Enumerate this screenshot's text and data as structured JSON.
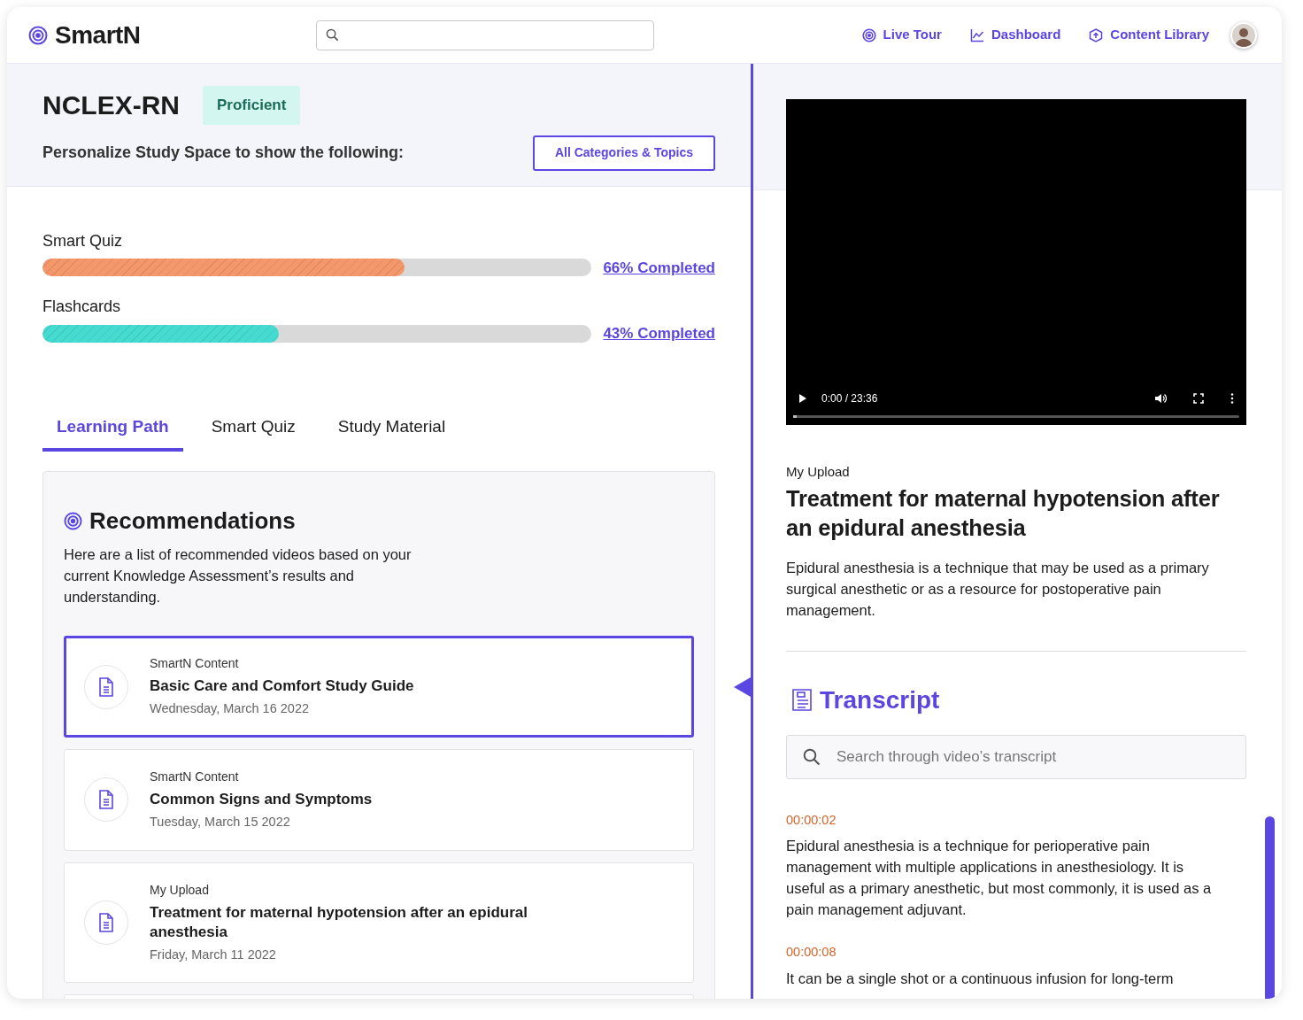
{
  "header": {
    "brand": "SmartN",
    "nav": [
      {
        "kind": "tour",
        "label": "Live Tour"
      },
      {
        "kind": "dashboard",
        "label": "Dashboard"
      },
      {
        "kind": "library",
        "label": "Content Library"
      }
    ]
  },
  "exam": {
    "title": "NCLEX-RN",
    "badge": "Proficient",
    "prompt": "Personalize Study Space to show the following:",
    "filter_button": "All Categories & Topics"
  },
  "progress": [
    {
      "label": "Smart Quiz",
      "level": 0.66,
      "link": "66% Completed",
      "color": "#f4976a"
    },
    {
      "label": "Flashcards",
      "level": 0.43,
      "link": "43% Completed",
      "color": "#45dbd0"
    }
  ],
  "tabs": [
    {
      "label": "Learning Path",
      "selected": true
    },
    {
      "label": "Smart Quiz",
      "selected": false
    },
    {
      "label": "Study Material",
      "selected": false
    }
  ],
  "recommendations": {
    "title": "Recommendations",
    "description": "Here are a list of recommended videos based on your current Knowledge Assessment’s results and understanding.",
    "more_below": true,
    "items": [
      {
        "source": "SmartN Content",
        "title": "Basic Care and Comfort Study Guide",
        "date": "Wednesday, March 16 2022",
        "selected": true
      },
      {
        "source": "SmartN Content",
        "title": "Common Signs and Symptoms",
        "date": "Tuesday, March 15 2022",
        "selected": false
      },
      {
        "source": "My Upload",
        "title": "Treatment for maternal hypotension after an epidural anesthesia",
        "date": "Friday, March 11 2022",
        "selected": false
      }
    ]
  },
  "video": {
    "time": "0:00 / 23:36",
    "level": 0
  },
  "details": {
    "source": "My Upload",
    "title": "Treatment for maternal hypotension after an epidural anesthesia",
    "description": "Epidural anesthesia is a technique that may be used as a primary surgical anesthetic or as a resource for postoperative pain management."
  },
  "transcript": {
    "title": "Transcript",
    "search": {
      "placeholder": "Search through video’s transcript"
    },
    "entries": [
      {
        "time": "00:00:02",
        "text": "Epidural anesthesia is a technique for perioperative pain management with multiple applications in anesthesiology. It is useful as a primary anesthetic, but most commonly, it is used as a pain management adjuvant."
      },
      {
        "time": "00:00:08",
        "text": "It can be a single shot or a continuous infusion for long-term"
      }
    ]
  }
}
